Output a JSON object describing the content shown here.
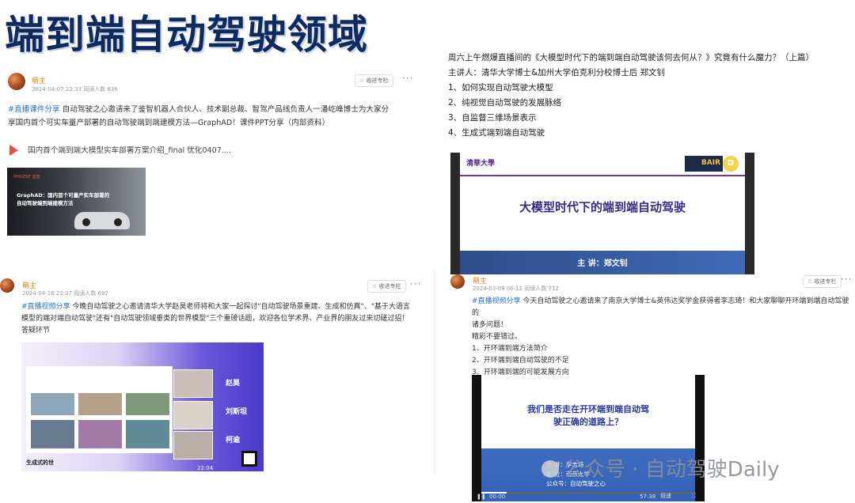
{
  "banner": {
    "title": "端到端自动驾驶领域"
  },
  "post1": {
    "author": "萌主",
    "meta": "2024-04-07 22:33   阅读人数 636",
    "collect": "☆ 收进专栏",
    "more": "···",
    "tag": "#直播课件分享",
    "text_a": " 自动驾驶之心邀请来了鉴智机器人合伙人、技术副总裁、智驾产品线负责人一潘屹峰博士为大家分",
    "text_b": "享国内首个可实车量产部署的自动驾驶端到端建模方法—GraphAD！课件PPT分享（内部资料）",
    "attachment": "国内首个端到端大模型实车部署方案介绍_final 优化0407....",
    "thumb_logo": "PHIGENT 鉴智",
    "thumb_title_1": "GraphAD：国内首个可量产实车部署的",
    "thumb_title_2": "自动驾驶端到端建模方法"
  },
  "post2": {
    "line1": "周六上午燃爆直播间的《大模型时代下的端到端自动驾驶该何去何从？》究竟有什么魔力？（上篇）",
    "line2": "主讲人：清华大学博士&加州大学伯克利分校博士后 郑文钊",
    "item1": "1、如何实现自动驾驶大模型",
    "item2": "2、纯视觉自动驾驶的发展脉络",
    "item3": "3、自监督三维场景表示",
    "item4": "4、生成式端到端自动驾驶",
    "slide_logo": "清華大學",
    "slide_badge": "BAIR",
    "slide_d": "D",
    "slide_title": "大模型时代下的端到端自动驾驶",
    "slide_speaker": "主 讲：郑文钊"
  },
  "post3": {
    "author": "萌主",
    "meta": "2024-04-16 23:37   阅读人数 697",
    "collect": "☆ 收进专栏",
    "more": "···",
    "tag": "#直播视频分享",
    "text_a": " 今晚自动驾驶之心邀请清华大学赵昊老师将和大家一起探讨\"自动驾驶场景重建、生成和仿真\"、\"基于大语言",
    "text_b": "模型的端对端自动驾驶\"还有\"自动驾驶领域垂类的世界模型\"三个重磅话题，欢迎各位学术界、产业界的朋友过来切磋过招！",
    "text_c": "答疑环节",
    "name1": "赵昊",
    "name2": "刘斯坦",
    "name3": "柯逾",
    "bottom": "生成式的世",
    "time": "22:04"
  },
  "post4": {
    "author": "萌主",
    "meta": "2024-03-09 00:12   阅读人数 712",
    "collect": "☆ 收进专栏",
    "more": "···",
    "tag": "#直播视频分享",
    "text_a": " 今天自动驾驶之心邀请来了南京大学博士&英伟达奖学金获得者李志琦！和大家聊聊开环端到端自动驾驶的",
    "text_b": "诸多问题！",
    "text_c": "精彩不要错过。",
    "item1": "1、开环端到端方法简介",
    "item2": "2、开环端到端自动驾驶的不足",
    "item3": "3、开环端到端的可能发展方向",
    "video_q1": "我们是否走在开环端到端自动驾",
    "video_q2": "驶正确的道路上？",
    "info1": "主 讲：李志琦",
    "info2": "单 位：南京大学",
    "info3": "公众号：自动驾驶之心",
    "time_start": "00:00",
    "time_end": "57:38",
    "speed": "倍速"
  },
  "watermark": {
    "text": "公众号 · 自动驾驶Daily"
  }
}
